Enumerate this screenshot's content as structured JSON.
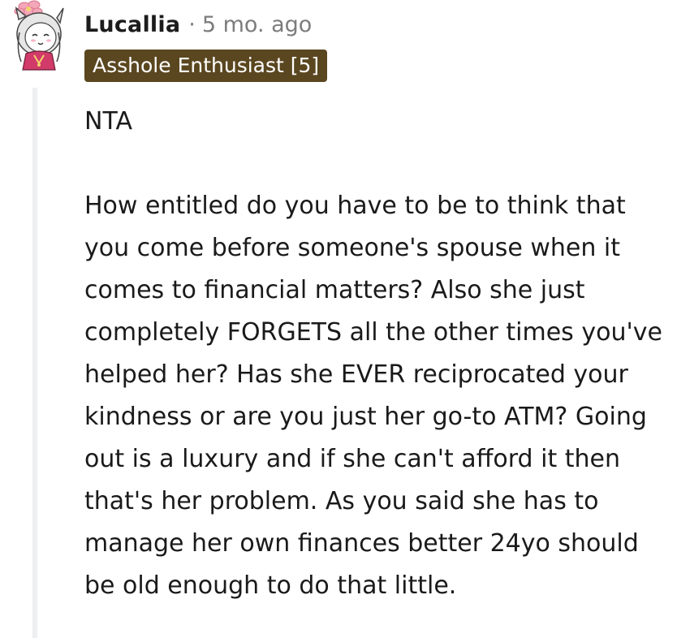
{
  "comment": {
    "username": "Lucallia",
    "separator": "·",
    "timestamp": "5 mo. ago",
    "flair": "Asshole Enthusiast [5]",
    "avatar_icon": "anime-girl-avatar-icon",
    "verdict": "NTA",
    "body": "How entitled do you have to be to think that you come before someone's spouse when it comes to financial matters? Also she just completely FORGETS all the other times you've helped her? Has she EVER reciprocated your kindness or are you just her go-to ATM? Going out is a luxury and if she can't afford it then that's her problem. As you said she has to manage her own finances better 24yo should be old enough to do that little."
  },
  "colors": {
    "flair_bg": "#5a4720",
    "flair_text": "#ffffff",
    "meta_text": "#7c7c7c",
    "thread_line": "#edeff1"
  }
}
